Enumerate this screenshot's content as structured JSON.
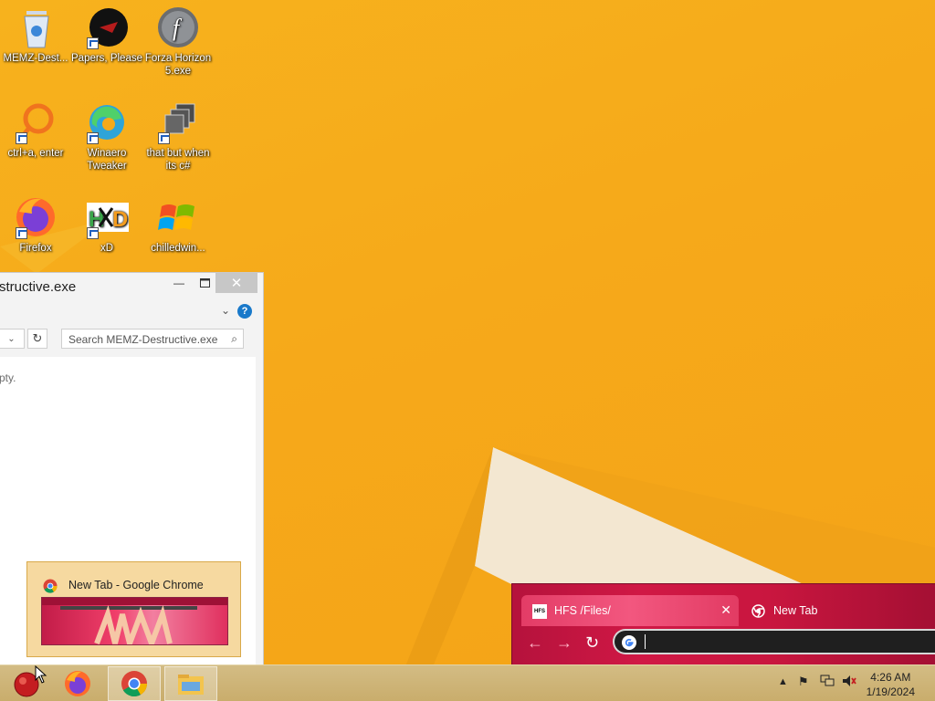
{
  "desktop": {
    "icons": [
      {
        "label": "MEMZ-Dest...",
        "icon": "recycle-bin-icon"
      },
      {
        "label": "Papers, Please",
        "icon": "papers-please-icon"
      },
      {
        "label": "Forza Horizon 5.exe",
        "icon": "flash-icon"
      },
      {
        "label": "ctrl+a, enter",
        "icon": "orange-ring-icon"
      },
      {
        "label": "Winaero Tweaker",
        "icon": "edge-swirl-icon"
      },
      {
        "label": "that but when its c#",
        "icon": "stacked-windows-icon"
      },
      {
        "label": "Firefox",
        "icon": "firefox-icon"
      },
      {
        "label": "xD",
        "icon": "hxd-icon"
      },
      {
        "label": "chilledwin...",
        "icon": "windows-flag-icon"
      }
    ]
  },
  "explorer": {
    "title": "structive.exe",
    "search_placeholder": "Search MEMZ-Destructive.exe",
    "empty_text": "pty."
  },
  "thumbnail": {
    "label": "New Tab - Google Chrome"
  },
  "chrome": {
    "tabs": [
      {
        "label": "HFS /Files/",
        "icon": "hfs-icon",
        "active": true
      },
      {
        "label": "New Tab",
        "icon": "chrome-icon",
        "active": false
      }
    ]
  },
  "taskbar": {
    "apps": [
      "start-orb-icon",
      "firefox-icon",
      "chrome-icon",
      "file-explorer-icon"
    ],
    "clock": {
      "time": "4:26 AM",
      "date": "1/19/2024"
    }
  },
  "colors": {
    "wallpaper": "#f6a91a",
    "chrome_theme": "#c9163f",
    "taskbar": "#cdb277"
  }
}
